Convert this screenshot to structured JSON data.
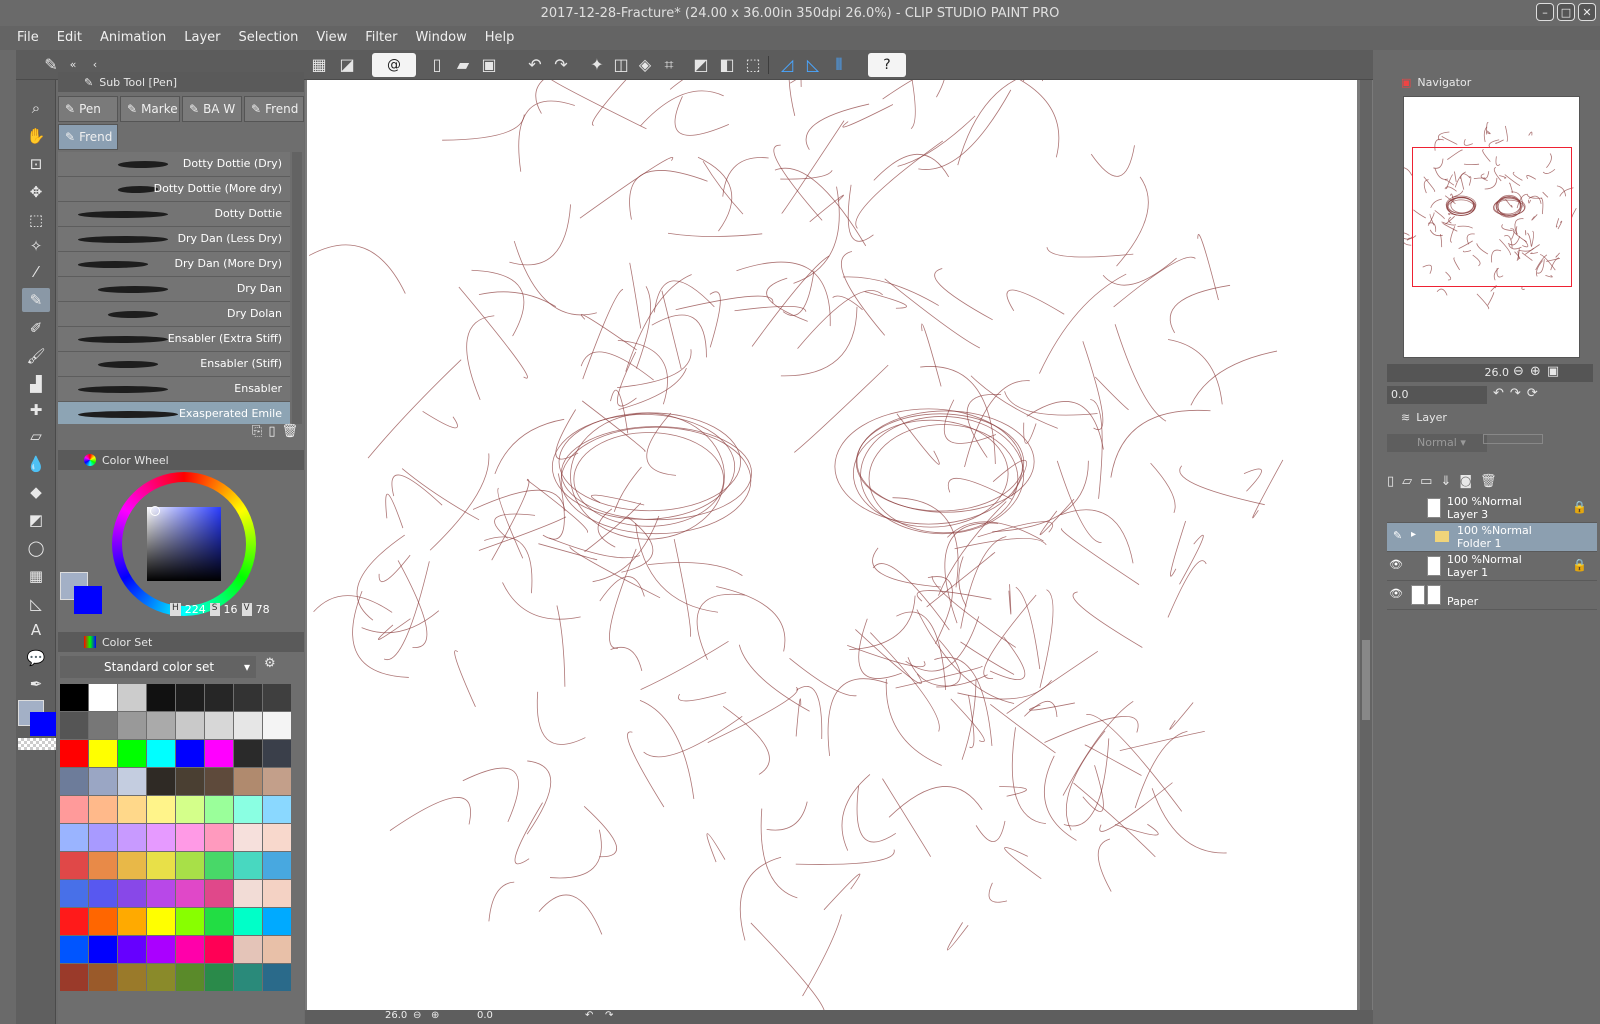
{
  "window": {
    "title": "2017-12-28-Fracture* (24.00 x 36.00in 350dpi 26.0%)  - CLIP STUDIO PAINT PRO"
  },
  "menu": [
    "File",
    "Edit",
    "Animation",
    "Layer",
    "Selection",
    "View",
    "Filter",
    "Window",
    "Help"
  ],
  "subtool": {
    "panel_title": "Sub Tool [Pen]",
    "tabs": [
      "Pen",
      "Marke",
      "BA W",
      "Frend"
    ],
    "active_tab": "Frend",
    "brushes": [
      "Dotty Dottie (Dry)",
      "Dotty Dottie (More dry)",
      "Dotty Dottie",
      "Dry Dan (Less Dry)",
      "Dry Dan (More Dry)",
      "Dry Dan",
      "Dry Dolan",
      "Ensabler (Extra Stiff)",
      "Ensabler (Stiff)",
      "Ensabler",
      "Exasperated Emile"
    ],
    "selected_brush": "Exasperated Emile"
  },
  "color_wheel": {
    "panel_title": "Color Wheel",
    "h": "224",
    "s": "16",
    "v": "78",
    "main_color": "#a3b0c6",
    "sub_color": "#0000ff"
  },
  "color_set": {
    "panel_title": "Color Set",
    "set_name": "Standard color set",
    "colors": [
      "#000000",
      "#ffffff",
      "#cccccc",
      "#111111",
      "#1d1d1d",
      "#262626",
      "#333333",
      "#3f3f3f",
      "#555555",
      "#777777",
      "#999999",
      "#aaaaaa",
      "#c9c9c9",
      "#d7d7d7",
      "#e6e6e6",
      "#f4f4f4",
      "#ff0000",
      "#ffff00",
      "#00ff00",
      "#00ffff",
      "#0000ff",
      "#ff00ff",
      "#2a2a2a",
      "#3a3f4a",
      "#6d7c9a",
      "#9aa6c4",
      "#c4cde0",
      "#2f2a25",
      "#4a3f32",
      "#5e4a3b",
      "#b08a6e",
      "#c39f8a",
      "#ff9a9a",
      "#ffb98a",
      "#ffd88a",
      "#fff48a",
      "#d4ff8a",
      "#9aff9a",
      "#8affe2",
      "#8ad8ff",
      "#9ab4ff",
      "#a89aff",
      "#c89aff",
      "#e69aff",
      "#ff9ae6",
      "#ff9abe",
      "#f6e0dc",
      "#f8d8cc",
      "#e04848",
      "#e88a48",
      "#e8b848",
      "#e8e048",
      "#a8e048",
      "#48d868",
      "#48d8c0",
      "#48a8e0",
      "#4870e8",
      "#5858f0",
      "#8848e8",
      "#b848e8",
      "#e048c8",
      "#e0488a",
      "#f2dcd6",
      "#f4d2c4",
      "#ff1a1a",
      "#ff6600",
      "#ffaa00",
      "#ffff00",
      "#88ff00",
      "#22dd44",
      "#00ffc8",
      "#00aaff",
      "#0055ff",
      "#0000ff",
      "#6600ff",
      "#aa00ff",
      "#ff00aa",
      "#ff0055",
      "#e4c4b8",
      "#e8c0a8",
      "#9a3a2a",
      "#9a5a2a",
      "#9a7a2a",
      "#8a8a2a",
      "#5a8a2a",
      "#2a8a4a",
      "#2a8a7a",
      "#2a6a8a"
    ]
  },
  "navigator": {
    "panel_title": "Navigator",
    "zoom": "26.0",
    "rotation": "0.0"
  },
  "layer_panel": {
    "panel_title": "Layer",
    "blend_mode": "Normal",
    "layers": [
      {
        "line1": "100 %Normal",
        "line2": "Layer 3",
        "visible": false,
        "folder": false,
        "selected": false,
        "locked": true
      },
      {
        "line1": "100 %Normal",
        "line2": "Folder 1",
        "visible": false,
        "folder": true,
        "selected": true,
        "locked": false
      },
      {
        "line1": "100 %Normal",
        "line2": "Layer 1",
        "visible": true,
        "folder": false,
        "selected": false,
        "locked": true
      },
      {
        "line1": "",
        "line2": "Paper",
        "visible": true,
        "folder": false,
        "selected": false,
        "locked": false
      }
    ]
  },
  "canvas_status": {
    "zoom": "26.0",
    "rotation": "0.0"
  },
  "colors": {
    "sketch_stroke": "#8a3a3a"
  }
}
